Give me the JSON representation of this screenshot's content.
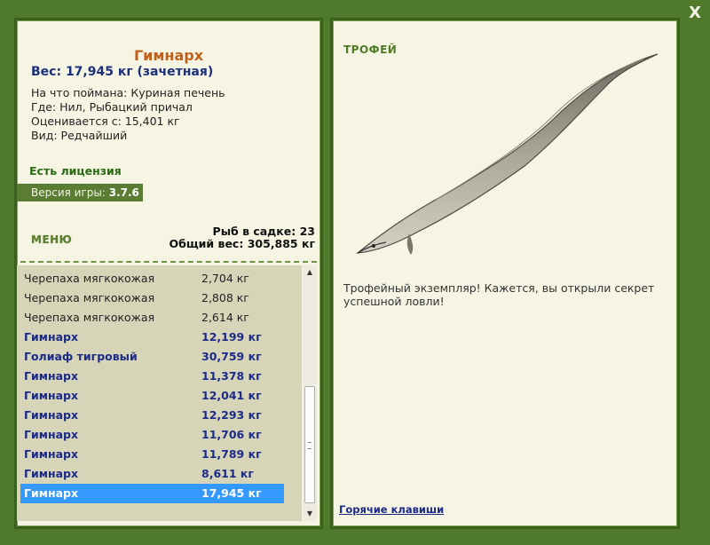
{
  "close_label": "X",
  "catch": {
    "name": "Гимнарх",
    "weight": "Вес: 17,945 кг (зачетная)",
    "details": [
      "На что поймана: Куриная печень",
      "Где: Нил, Рыбацкий причал",
      "Оценивается с: 15,401 кг",
      "Вид: Редчайший"
    ]
  },
  "license": "Есть лицензия",
  "version": {
    "label": "Версия игры:",
    "value": "3.7.6"
  },
  "menu": "МЕНЮ",
  "cage": {
    "count": "Рыб в садке: 23",
    "total": "Общий вес: 305,885 кг"
  },
  "list": [
    {
      "name": "Черепаха мягкокожая",
      "weight": "2,704 кг",
      "style": "plain"
    },
    {
      "name": "Черепаха мягкокожая",
      "weight": "2,808 кг",
      "style": "plain"
    },
    {
      "name": "Черепаха мягкокожая",
      "weight": "2,614 кг",
      "style": "plain"
    },
    {
      "name": "Гимнарх",
      "weight": "12,199 кг",
      "style": "bold"
    },
    {
      "name": "Голиаф тигровый",
      "weight": "30,759 кг",
      "style": "bold"
    },
    {
      "name": "Гимнарх",
      "weight": "11,378 кг",
      "style": "bold"
    },
    {
      "name": "Гимнарх",
      "weight": "12,041 кг",
      "style": "bold"
    },
    {
      "name": "Гимнарх",
      "weight": "12,293 кг",
      "style": "bold"
    },
    {
      "name": "Гимнарх",
      "weight": "11,706 кг",
      "style": "bold"
    },
    {
      "name": "Гимнарх",
      "weight": "11,789 кг",
      "style": "bold"
    },
    {
      "name": "Гимнарх",
      "weight": "8,611 кг",
      "style": "bold"
    },
    {
      "name": "Гимнарх",
      "weight": "17,945 кг",
      "style": "sel"
    }
  ],
  "trophy_heading": "ТРОФЕЙ",
  "trophy_text": "Трофейный экземпляр! Кажется, вы открыли секрет успешной ловли!",
  "hotkeys": "Горячие клавиши",
  "colors": {
    "frame": "#4f7a2c",
    "panel": "#f6f4e3",
    "selection": "#3399ff",
    "name": "#c0601a"
  }
}
